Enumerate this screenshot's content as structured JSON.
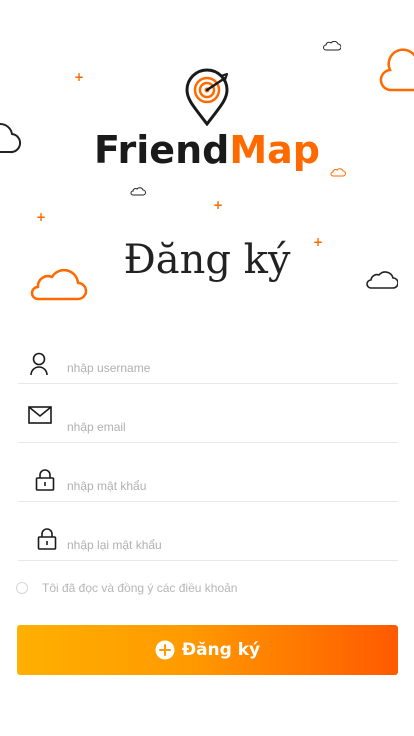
{
  "brand": {
    "name_part1": "Friend",
    "name_part2": "Map",
    "logo_icon": "location-pin-target-icon"
  },
  "page_title": "Đăng ký",
  "form": {
    "username_placeholder": "nhập username",
    "email_placeholder": "nhập email",
    "password_placeholder": "nhập mật khẩu",
    "confirm_password_placeholder": "nhập lại mật khẩu",
    "terms_label": "Tôi đã đọc và đồng ý các điều khoản",
    "terms_checked": false,
    "submit_label": "Đăng ký"
  },
  "icons": {
    "username": "user-icon",
    "email": "mail-icon",
    "password": "lock-icon",
    "confirm_password": "lock-icon",
    "submit": "plus-circle-icon"
  },
  "colors": {
    "accent": "#ff6a00",
    "gradient_start": "#ffb000",
    "gradient_end": "#ff5a00",
    "text_dark": "#222222",
    "placeholder": "#b0b0b0"
  }
}
